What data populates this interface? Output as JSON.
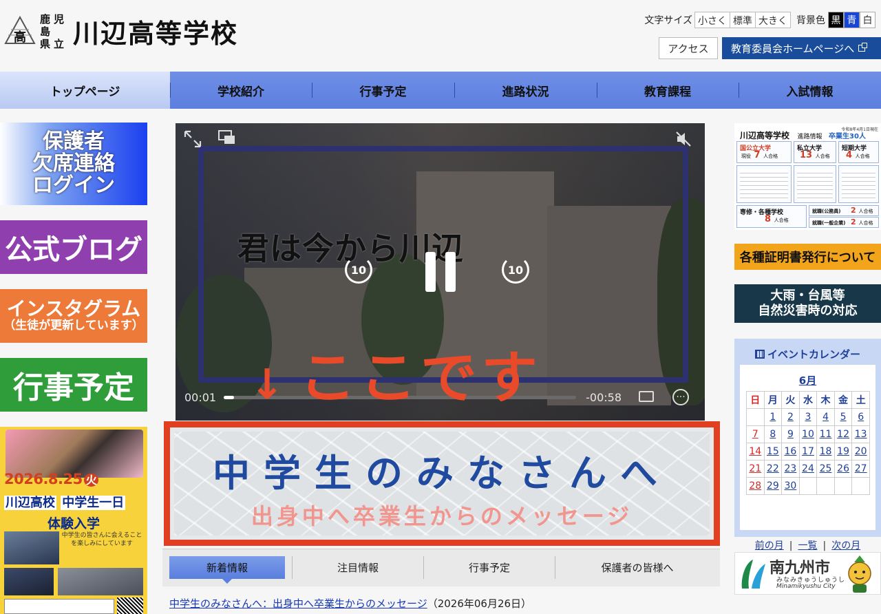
{
  "header": {
    "logo_emblem": "高",
    "logo_small_1": "鹿児島",
    "logo_small_2": "県立",
    "school_name": "川辺高等学校",
    "font_size_label": "文字サイズ",
    "font_size_options": [
      "小さく",
      "標準",
      "大きく"
    ],
    "bg_label": "背景色",
    "bg_options": [
      "黒",
      "青",
      "白"
    ],
    "access_label": "アクセス",
    "board_label": "教育委員会ホームページへ"
  },
  "nav": {
    "items": [
      "トップページ",
      "学校紹介",
      "行事予定",
      "進路状況",
      "教育課程",
      "入試情報"
    ]
  },
  "left_banners": {
    "guardian_1": "保護者",
    "guardian_2": "欠席連絡",
    "guardian_3": "ログイン",
    "blog": "公式ブログ",
    "instagram": "インスタグラム",
    "instagram_sub": "（生徒が更新しています）",
    "event": "行事予定",
    "poster_date": "2026.8.25",
    "poster_dow": "火",
    "poster_school": "川辺高校",
    "poster_title": "中学生一日",
    "poster_sub": "体験入学",
    "poster_note": "中学生の皆さんに会えることを楽しみにしています"
  },
  "video": {
    "caption": "君は今から川辺",
    "skip_back": "10",
    "skip_forward": "10",
    "time_current": "00:01",
    "time_remaining": "-00:58",
    "progress": 0.03,
    "more_label": "···",
    "here_arrow": "↓",
    "here_text": "ここです"
  },
  "message_banner": {
    "title": "中学生のみなさんへ",
    "subtitle": "出身中へ卒業生からのメッセージ"
  },
  "tabs": {
    "items": [
      "新着情報",
      "注目情報",
      "行事予定",
      "保護者の皆様へ"
    ]
  },
  "news": {
    "link": "中学生のみなさんへ：出身中へ卒業生からのメッセージ",
    "date": "（2026年06月26日）"
  },
  "career": {
    "school": "川辺高等学校",
    "info": "進路情報",
    "graduates": "卒業生30人",
    "date": "令和8年4月1日現在",
    "national_label": "国公立大学",
    "national_prefix": "現役",
    "national_count": "7",
    "private_label": "私立大学",
    "private_count": "13",
    "junior_label": "短期大学",
    "junior_count": "4",
    "unit": "人合格",
    "vocational_label": "専修・各種学校",
    "vocational_count": "8",
    "employ_public_label": "就職(公務員)",
    "employ_public_count": "2",
    "employ_general_label": "就職(一般企業)",
    "employ_general_count": "2"
  },
  "right_banners": {
    "cert": "各種証明書発行について",
    "disaster_1": "大雨・台風等",
    "disaster_2": "自然災害時の対応"
  },
  "calendar": {
    "title": "イベントカレンダー",
    "month": "6月",
    "weekdays": [
      "日",
      "月",
      "火",
      "水",
      "木",
      "金",
      "土"
    ],
    "weeks": [
      [
        "",
        "1",
        "2",
        "3",
        "4",
        "5",
        "6"
      ],
      [
        "7",
        "8",
        "9",
        "10",
        "11",
        "12",
        "13"
      ],
      [
        "14",
        "15",
        "16",
        "17",
        "18",
        "19",
        "20"
      ],
      [
        "21",
        "22",
        "23",
        "24",
        "25",
        "26",
        "27"
      ],
      [
        "28",
        "29",
        "30",
        "",
        "",
        "",
        ""
      ]
    ],
    "prev": "前の月",
    "list": "一覧",
    "next": "次の月",
    "sep": "|"
  },
  "city": {
    "name": "南九州市",
    "kana": "みなみきゅうしゅうし",
    "roman": "Minamikyushu City"
  },
  "colors": {
    "nav": "#5c7ede",
    "accent_red": "#e23e22",
    "board_blue": "#1a4c9c",
    "cert_orange": "#f2a51b"
  }
}
